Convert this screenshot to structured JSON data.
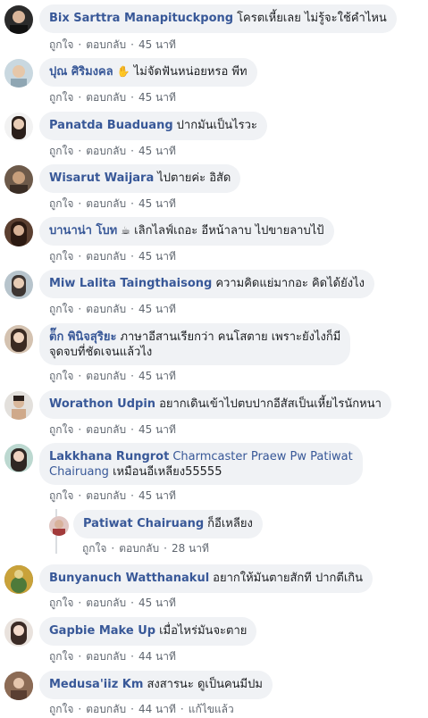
{
  "actions": {
    "like": "ถูกใจ",
    "reply": "ตอบกลับ",
    "edited": "แก้ไขแล้ว"
  },
  "comments": [
    {
      "author": "Bix Sarttra Manapituckpong",
      "text": "โครตเหี้ยเลย ไม่รู้จะใช้คำไหน",
      "time": "45 นาที"
    },
    {
      "author": "ปุณ ศิริมงคล",
      "emoji": "✋",
      "text": "ไม่จัดฟันหน่อยหรอ พีท",
      "time": "45 นาที"
    },
    {
      "author": "Panatda Buaduang",
      "text": "ปากมันเป็นไรวะ",
      "time": "45 นาที"
    },
    {
      "author": "Wisarut Waijara",
      "text": "ไปตายค่ะ อิสัด",
      "time": "45 นาที"
    },
    {
      "author": "บานาน่า โบท",
      "emoji": "☕",
      "text": "เลิกไลฟ์เถอะ อีหน้าลาบ ไปขายลาบไป้",
      "time": "45 นาที"
    },
    {
      "author": "Miw Lalita Taingthaisong",
      "text": "ความคิดแย่มากอะ คิดได้ยังไง",
      "time": "45 นาที"
    },
    {
      "author": "ต็๊ก พินิจสุริยะ",
      "text": "ภาษาอีสานเรียกว่า คนโสตาย เพราะยังไงก็มี",
      "text2": "จุดจบที่ชัดเจนแล้วไง",
      "time": "45 นาที"
    },
    {
      "author": "Worathon Udpin",
      "text": "อยากเดินเข้าไปตบปากอีสัสเป็นเหี้ยไรนักหนา",
      "time": "45 นาที"
    },
    {
      "author": "Lakkhana Rungrot",
      "mention": "Charmcaster Praew Pw Patiwat",
      "mention2": "Chairuang",
      "text": "เหมือนอีเหลียง55555",
      "time": "45 นาที"
    },
    {
      "author": "Patiwat Chairuang",
      "text": "ก็อีเหลียง",
      "time": "28 นาที"
    },
    {
      "author": "Bunyanuch Watthanakul",
      "text": "อยากให้มันตายสักที ปากตีเกิน",
      "time": "45 นาที"
    },
    {
      "author": "Gapbie Make Up",
      "text": "เมื่อไหร่มันจะตาย",
      "time": "44 นาที"
    },
    {
      "author": "Medusa'iiz Km",
      "text": "สงสารนะ ดูเป็นคนมีปม",
      "time": "44 นาที"
    }
  ]
}
